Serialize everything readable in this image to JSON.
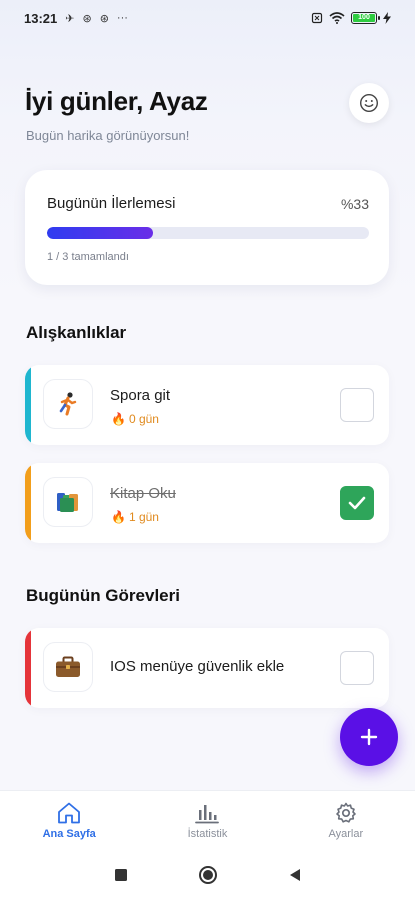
{
  "status_bar": {
    "time": "13:21",
    "battery_label": "100"
  },
  "header": {
    "greeting": "İyi günler, Ayaz",
    "subtitle": "Bugün harika görünüyorsun!"
  },
  "progress": {
    "title": "Bugünün İlerlemesi",
    "percent_label": "%33",
    "fraction": 0.33,
    "count_label": "1 / 3 tamamlandı"
  },
  "habits": {
    "section_title": "Alışkanlıklar",
    "items": [
      {
        "name": "Spora git",
        "streak": "0 gün",
        "icon": "running-icon",
        "accent": "#1fb6cf",
        "checked": false
      },
      {
        "name": "Kitap Oku",
        "streak": "1 gün",
        "icon": "books-icon",
        "accent": "#f29e1b",
        "checked": true
      }
    ]
  },
  "tasks": {
    "section_title": "Bugünün Görevleri",
    "items": [
      {
        "name": "IOS menüye güvenlik ekle",
        "icon": "briefcase-icon",
        "accent": "#e5343a",
        "checked": false
      }
    ]
  },
  "bottom_nav": {
    "items": [
      {
        "label": "Ana Sayfa",
        "icon": "home-icon",
        "active": true
      },
      {
        "label": "İstatistik",
        "icon": "bar-chart-icon",
        "active": false
      },
      {
        "label": "Ayarlar",
        "icon": "gear-icon",
        "active": false
      }
    ]
  },
  "colors": {
    "accent_blue": "#2f6fe6",
    "fab_purple": "#5a10e6",
    "check_green": "#2ea55a",
    "streak_orange": "#e08a1e"
  }
}
